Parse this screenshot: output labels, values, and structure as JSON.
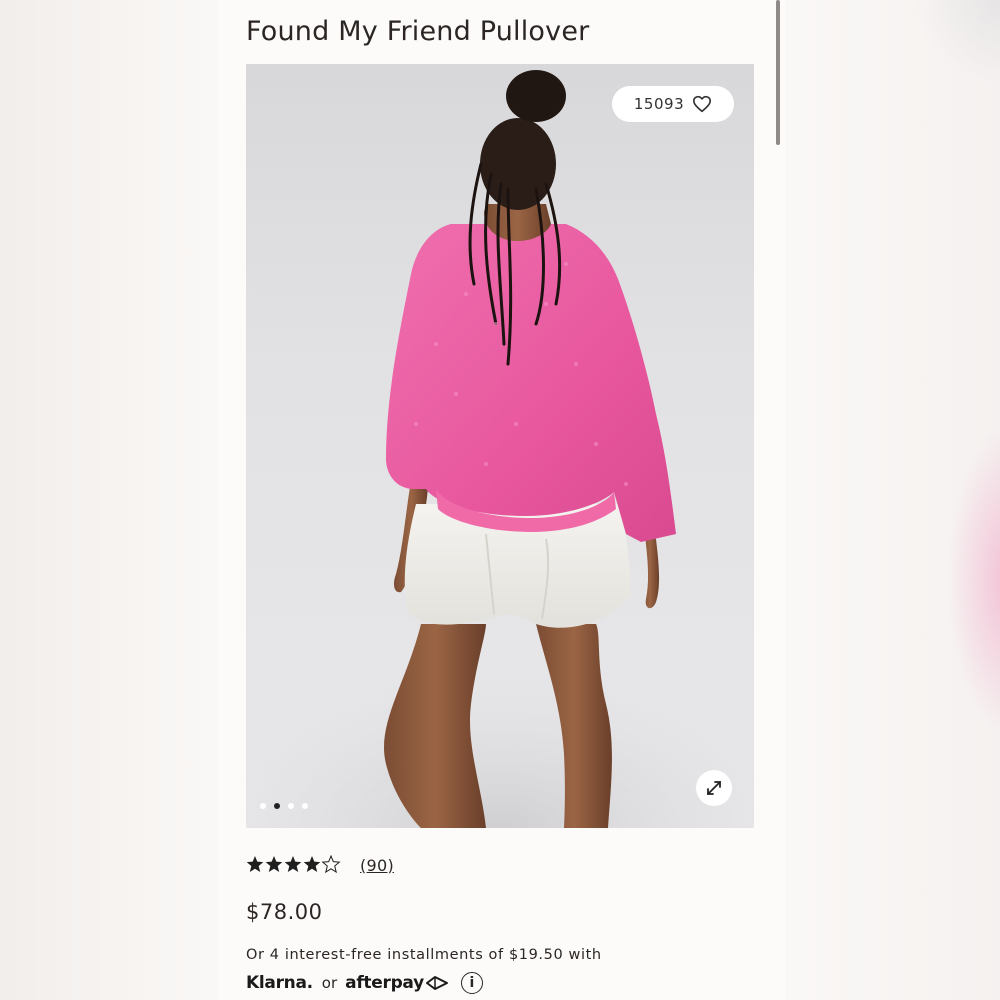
{
  "product": {
    "title": "Found My Friend Pullover",
    "like_count": "15093",
    "rating": 4.5,
    "reviews_count": "(90)",
    "price": "$78.00",
    "installments_text": "Or 4 interest-free installments of $19.50 with",
    "payment_klarna": "Klarna.",
    "payment_or": "or",
    "payment_afterpay": "afterpay",
    "info_glyph": "i"
  },
  "gallery": {
    "total_slides": 4,
    "active_slide": 2
  },
  "icons": {
    "like": "heart-icon",
    "expand": "expand-arrows-icon",
    "info": "info-icon",
    "afterpay_logo": "afterpay-arrows-icon"
  },
  "colors": {
    "sweater_pink": "#e8579e",
    "page_bg": "#fdfbf9",
    "text": "#2b2623"
  }
}
